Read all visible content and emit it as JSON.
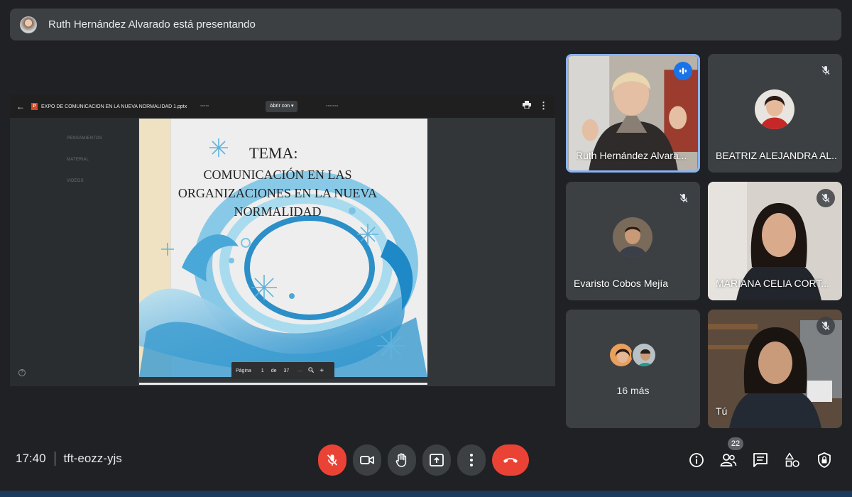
{
  "banner": {
    "text": "Ruth Hernández Alvarado está presentando"
  },
  "presentation": {
    "file_name": "EXPO DE COMUNICACION EN LA NUEVA NORMALIDAD 1.pptx",
    "file_icon": "P",
    "open_with": "Abrir con ▾",
    "sidebar_items": [
      "PENSAMIENTOS",
      "MATERIAL",
      "VIDEOS"
    ],
    "slide": {
      "title": "TEMA:",
      "subtitle_lines": [
        "COMUNICACIÓN EN LAS",
        "ORGANIZACIONES EN LA NUEVA",
        "NORMALIDAD"
      ]
    },
    "page_bar": {
      "label": "Página",
      "current": "1",
      "of": "de",
      "total": "37"
    }
  },
  "participants": [
    {
      "name": "Ruth Hernández Alvara...",
      "state": "speaking"
    },
    {
      "name": "BEATRIZ ALEJANDRA AL...",
      "state": "muted"
    },
    {
      "name": "Evaristo Cobos Mejía",
      "state": "muted"
    },
    {
      "name": "MARIANA CELIA CORT...",
      "state": "muted"
    },
    {
      "name": "16 más"
    },
    {
      "name": "Tú",
      "state": "muted"
    }
  ],
  "meeting": {
    "time": "17:40",
    "code": "tft-eozz-yjs",
    "people_count": "22"
  },
  "colors": {
    "background": "#202124",
    "tile": "#3c4043",
    "danger": "#ea4335",
    "active_border": "#8ab4f8",
    "speaking": "#1a73e8"
  }
}
